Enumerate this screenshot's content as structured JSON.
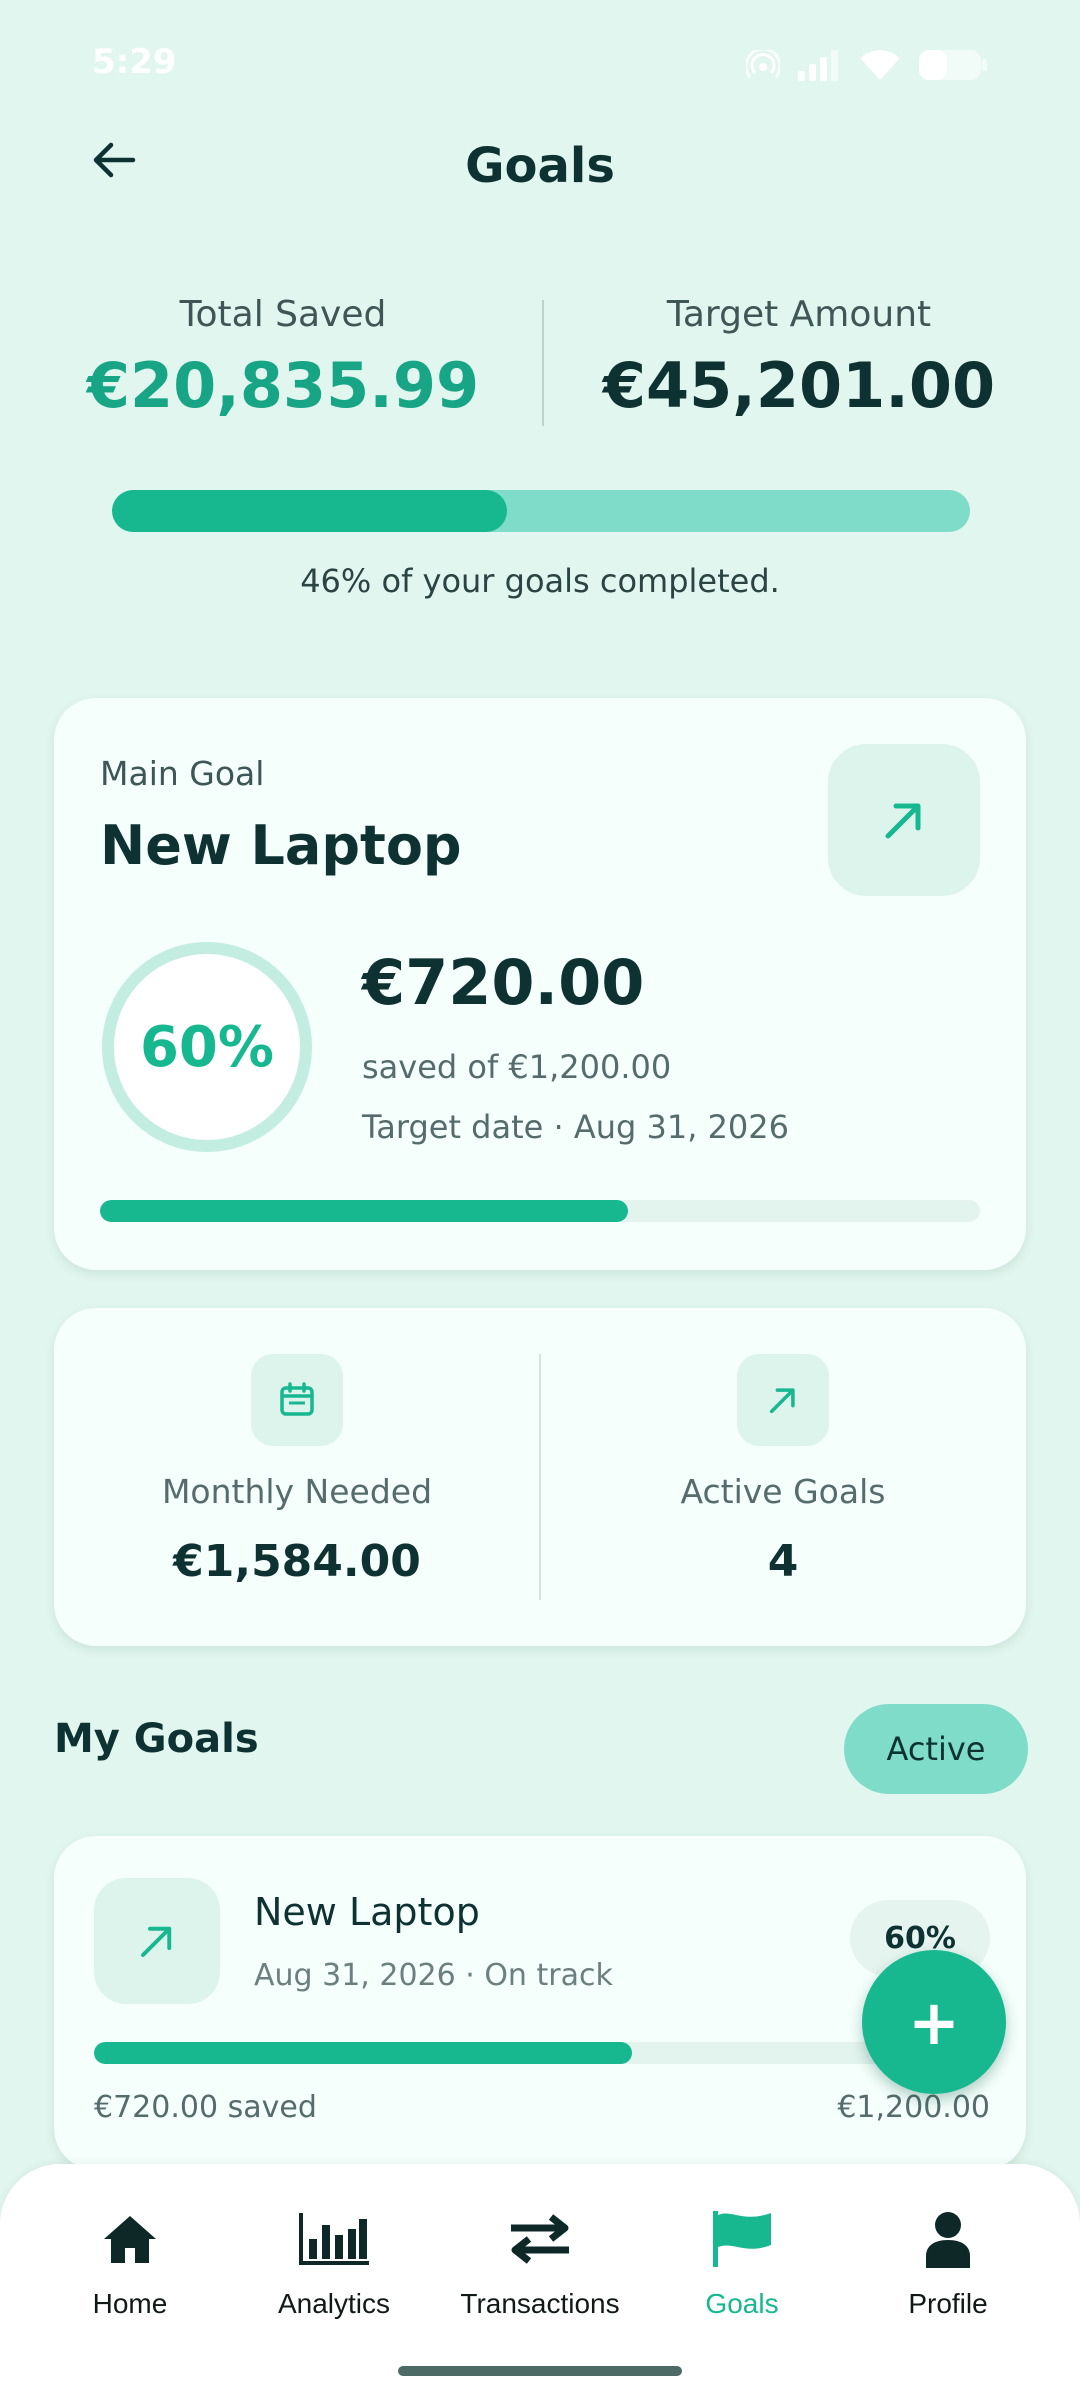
{
  "status_bar": {
    "time": "5:29"
  },
  "header": {
    "title": "Goals"
  },
  "summary": {
    "total_saved_label": "Total Saved",
    "total_saved_value": "€20,835.99",
    "target_label": "Target Amount",
    "target_value": "€45,201.00",
    "progress_fraction": 0.46,
    "progress_text": "46% of your goals completed."
  },
  "main_goal": {
    "label": "Main Goal",
    "title": "New Laptop",
    "percent": "60%",
    "progress_fraction": 0.6,
    "amount": "€720.00",
    "saved_of": "saved of €1,200.00",
    "target_date": "Target date · Aug 31, 2026",
    "icon": "arrow-up-right-icon"
  },
  "stats": {
    "monthly_label": "Monthly Needed",
    "monthly_value": "€1,584.00",
    "monthly_icon": "calendar-icon",
    "active_label": "Active Goals",
    "active_value": "4",
    "active_icon": "arrow-up-right-icon"
  },
  "my_goals": {
    "title": "My Goals",
    "filter": "Active",
    "items": [
      {
        "title": "New Laptop",
        "subtitle": "Aug 31, 2026 · On track",
        "percent": "60%",
        "progress_fraction": 0.6,
        "saved": "€720.00 saved",
        "target": "€1,200.00"
      }
    ]
  },
  "fab": {
    "label": "+"
  },
  "nav": {
    "items": [
      {
        "label": "Home",
        "icon": "home-icon"
      },
      {
        "label": "Analytics",
        "icon": "bar-chart-icon"
      },
      {
        "label": "Transactions",
        "icon": "transfer-arrows-icon"
      },
      {
        "label": "Goals",
        "icon": "flag-icon",
        "active": true
      },
      {
        "label": "Profile",
        "icon": "person-icon"
      }
    ]
  },
  "colors": {
    "background": "#E1F6EE",
    "accent": "#17B890",
    "accent_light": "#7EDCC8",
    "text_dark": "#0E3232"
  }
}
